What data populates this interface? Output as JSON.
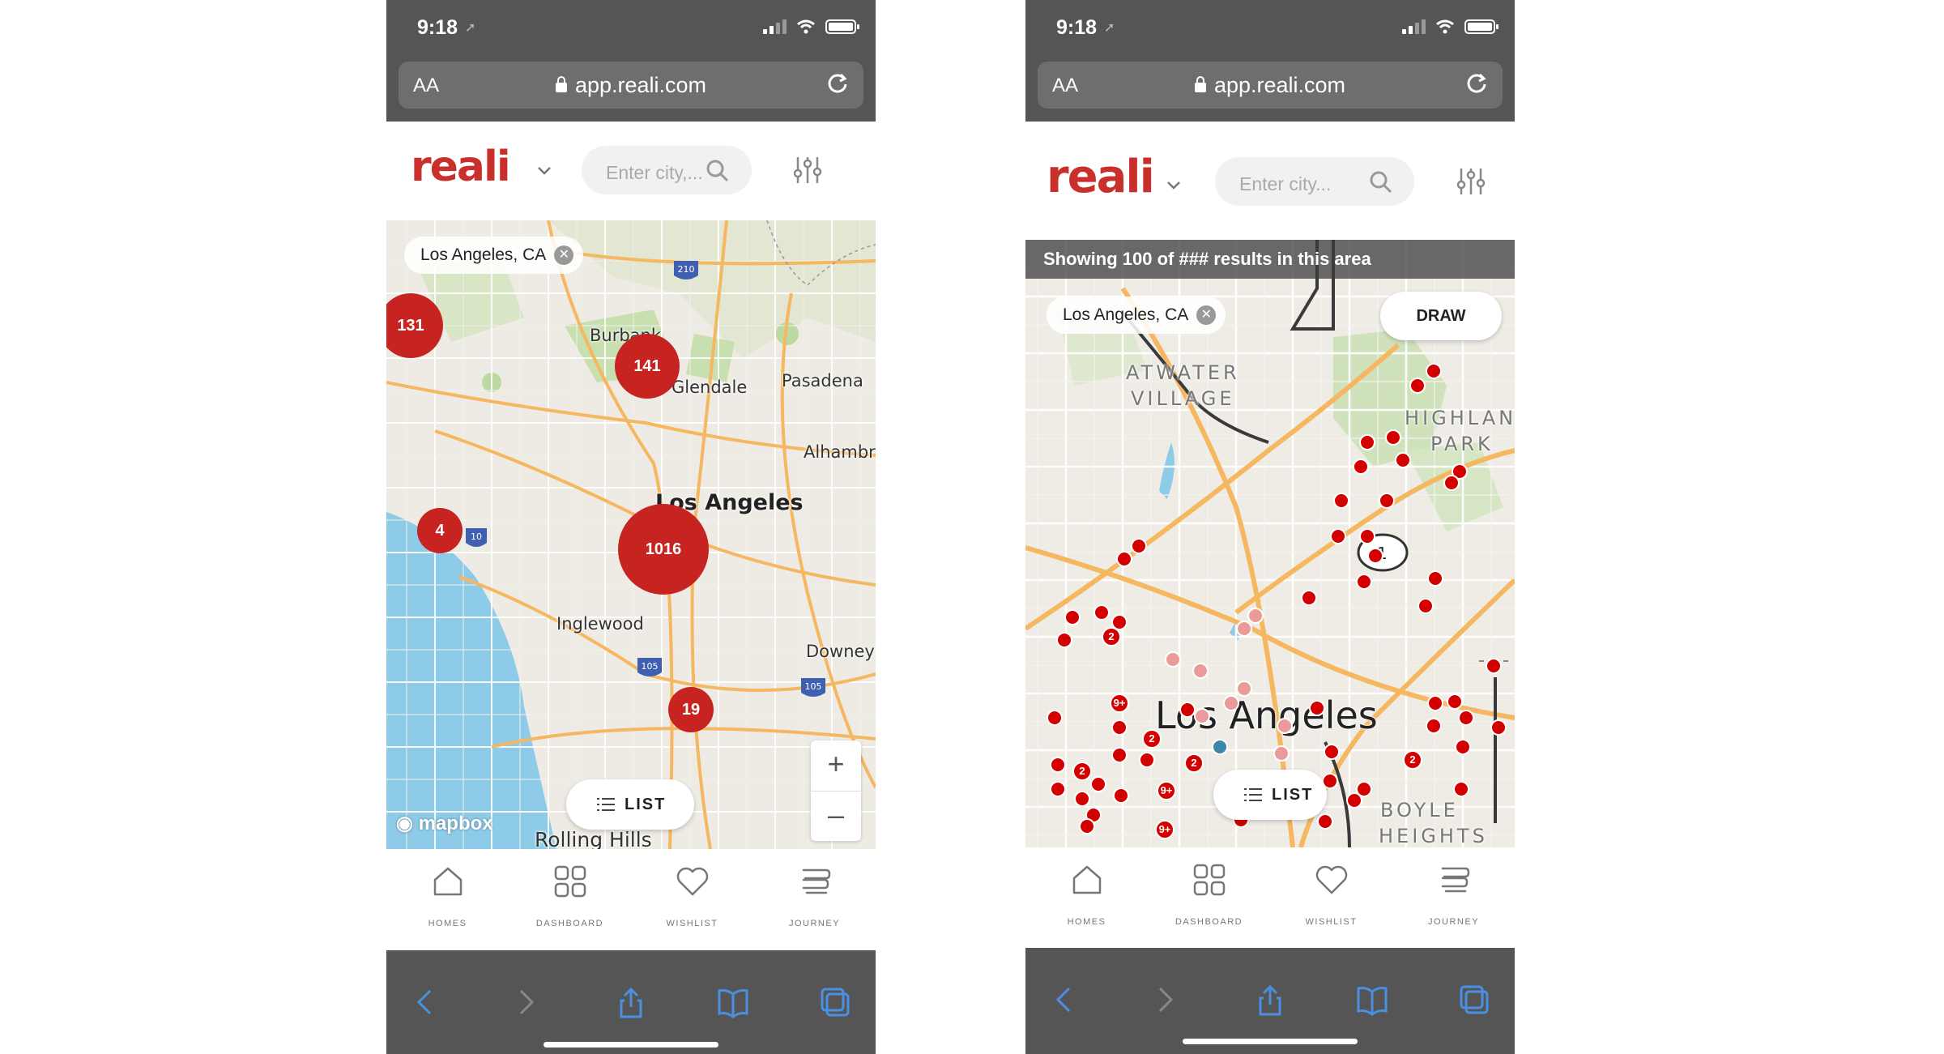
{
  "colors": {
    "brand": "#c9302c",
    "cluster": "#c72421",
    "pin": "#d40000",
    "pin_light": "#eb9a9a",
    "safari_chrome": "#555555",
    "water": "#8ecbe8"
  },
  "left": {
    "status": {
      "time": "9:18"
    },
    "browser": {
      "aa": "AA",
      "url": "app.reali.com"
    },
    "header": {
      "logo": "reali",
      "search_placeholder": "Enter city,..."
    },
    "map": {
      "chip": "Los Angeles, CA",
      "clusters": [
        "131",
        "141",
        "4",
        "1016",
        "19"
      ],
      "places": {
        "burbank": "Burbank",
        "glendale": "Glendale",
        "pasadena": "Pasadena",
        "alhambra": "Alhambr",
        "los_angeles": "Los Angeles",
        "inglewood": "Inglewood",
        "downey": "Downey",
        "rolling_hills": "Rolling Hills"
      },
      "highways": [
        "210",
        "10",
        "105",
        "105"
      ],
      "list_label": "LIST",
      "zoom_in": "+",
      "zoom_out": "–",
      "attribution": "mapbox"
    },
    "nav": [
      "HOMES",
      "DASHBOARD",
      "WISHLIST",
      "JOURNEY"
    ]
  },
  "right": {
    "status": {
      "time": "9:18"
    },
    "browser": {
      "aa": "AA",
      "url": "app.reali.com"
    },
    "header": {
      "logo": "reali",
      "search_placeholder": "Enter city..."
    },
    "map": {
      "banner": "Showing 100 of ### results in this area",
      "chip": "Los Angeles, CA",
      "draw_label": "DRAW",
      "places": {
        "atwater": "ATWATER",
        "village": "VILLAGE",
        "highland": "HIGHLANI",
        "park": "PARK",
        "los_angeles": "Los Angeles",
        "boyle": "BOYLE",
        "heights": "HEIGHTS"
      },
      "pin_counts": [
        "2",
        "9+",
        "2",
        "2",
        "2",
        "9+",
        "2",
        "9+"
      ],
      "list_label": "LIST"
    },
    "nav": [
      "HOMES",
      "DASHBOARD",
      "WISHLIST",
      "JOURNEY"
    ]
  }
}
